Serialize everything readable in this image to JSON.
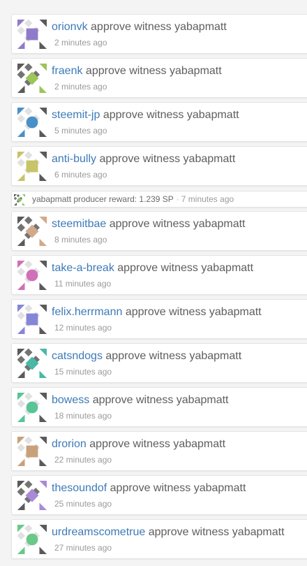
{
  "ops": [
    {
      "user": "orionvk",
      "action": "approve witness yabapmatt",
      "time": "2 minutes ago",
      "color": "#8f7bc9"
    },
    {
      "user": "fraenk",
      "action": "approve witness yabapmatt",
      "time": "2 minutes ago",
      "color": "#9cc55a"
    },
    {
      "user": "steemit-jp",
      "action": "approve witness yabapmatt",
      "time": "5 minutes ago",
      "color": "#4a90c8"
    },
    {
      "user": "anti-bully",
      "action": "approve witness yabapmatt",
      "time": "6 minutes ago",
      "color": "#c8c468"
    },
    {
      "user": "steemitbae",
      "action": "approve witness yabapmatt",
      "time": "8 minutes ago",
      "color": "#d2a98a"
    },
    {
      "user": "take-a-break",
      "action": "approve witness yabapmatt",
      "time": "11 minutes ago",
      "color": "#d070b8"
    },
    {
      "user": "felix.herrmann",
      "action": "approve witness yabapmatt",
      "time": "12 minutes ago",
      "color": "#8686d8"
    },
    {
      "user": "catsndogs",
      "action": "approve witness yabapmatt",
      "time": "15 minutes ago",
      "color": "#4ab8a6"
    },
    {
      "user": "bowess",
      "action": "approve witness yabapmatt",
      "time": "18 minutes ago",
      "color": "#58c498"
    },
    {
      "user": "drorion",
      "action": "approve witness yabapmatt",
      "time": "22 minutes ago",
      "color": "#c8a07a"
    },
    {
      "user": "thesoundof",
      "action": "approve witness yabapmatt",
      "time": "25 minutes ago",
      "color": "#a88ad8"
    },
    {
      "user": "urdreamscometrue",
      "action": "approve witness yabapmatt",
      "time": "27 minutes ago",
      "color": "#6ac888"
    }
  ],
  "virtual_op": {
    "text": "yabapmatt producer reward: 1.239 SP",
    "separator": "·",
    "time": "7 minutes ago",
    "color": "#8cc06a"
  }
}
